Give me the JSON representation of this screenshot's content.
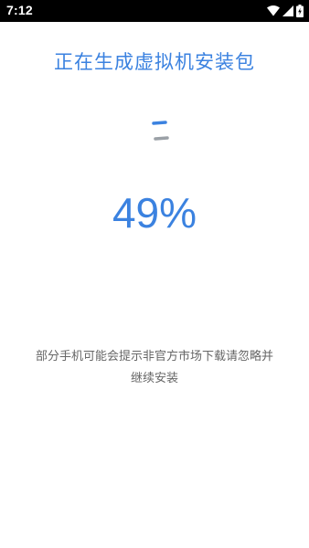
{
  "status_bar": {
    "time": "7:12",
    "icons": [
      "wifi-icon",
      "cellular-signal-icon",
      "battery-charging-icon"
    ]
  },
  "main": {
    "title": "正在生成虚拟机安装包",
    "progress_percent": 49,
    "progress_text": "49%",
    "note_line1": "部分手机可能会提示非官方市场下载请忽略并",
    "note_line2": "继续安装"
  },
  "colors": {
    "accent": "#3b82e0",
    "spinner_gray": "#9aa0a6",
    "note_text": "#666666",
    "status_bar_bg": "#000000"
  }
}
